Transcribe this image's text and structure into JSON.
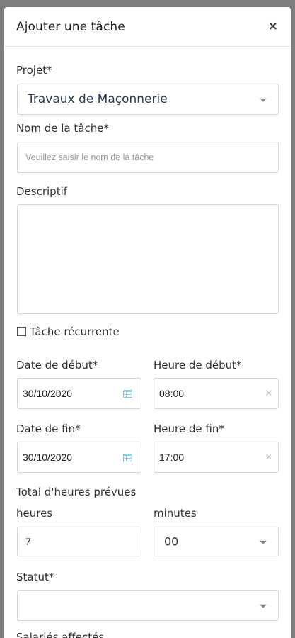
{
  "modal": {
    "title": "Ajouter une tâche",
    "close_glyph": "×"
  },
  "form": {
    "project_label": "Projet*",
    "project_value": "Travaux de Maçonnerie",
    "task_name_label": "Nom de la tâche*",
    "task_name_placeholder": "Veuillez saisir le nom de la tâche",
    "description_label": "Descriptif",
    "recurring_label": "Tâche récurrente",
    "start_date_label": "Date de début*",
    "start_date_value": "30/10/2020",
    "start_time_label": "Heure de début*",
    "start_time_value": "08:00",
    "end_date_label": "Date de fin*",
    "end_date_value": "30/10/2020",
    "end_time_label": "Heure de fin*",
    "end_time_value": "17:00",
    "total_hours_label": "Total d'heures prévues",
    "hours_label": "heures",
    "hours_value": "7",
    "minutes_label": "minutes",
    "minutes_value": "00",
    "status_label": "Statut*",
    "status_value": "",
    "assigned_label": "Salariés affectés",
    "clear_glyph": "×"
  },
  "icons": [
    "close-icon",
    "chevron-down-icon",
    "calendar-icon",
    "clear-icon",
    "checkbox-icon"
  ],
  "colors": {
    "accent": "#2f3b56",
    "calendar": "#8fc9d8",
    "border": "#d6d6d6"
  }
}
